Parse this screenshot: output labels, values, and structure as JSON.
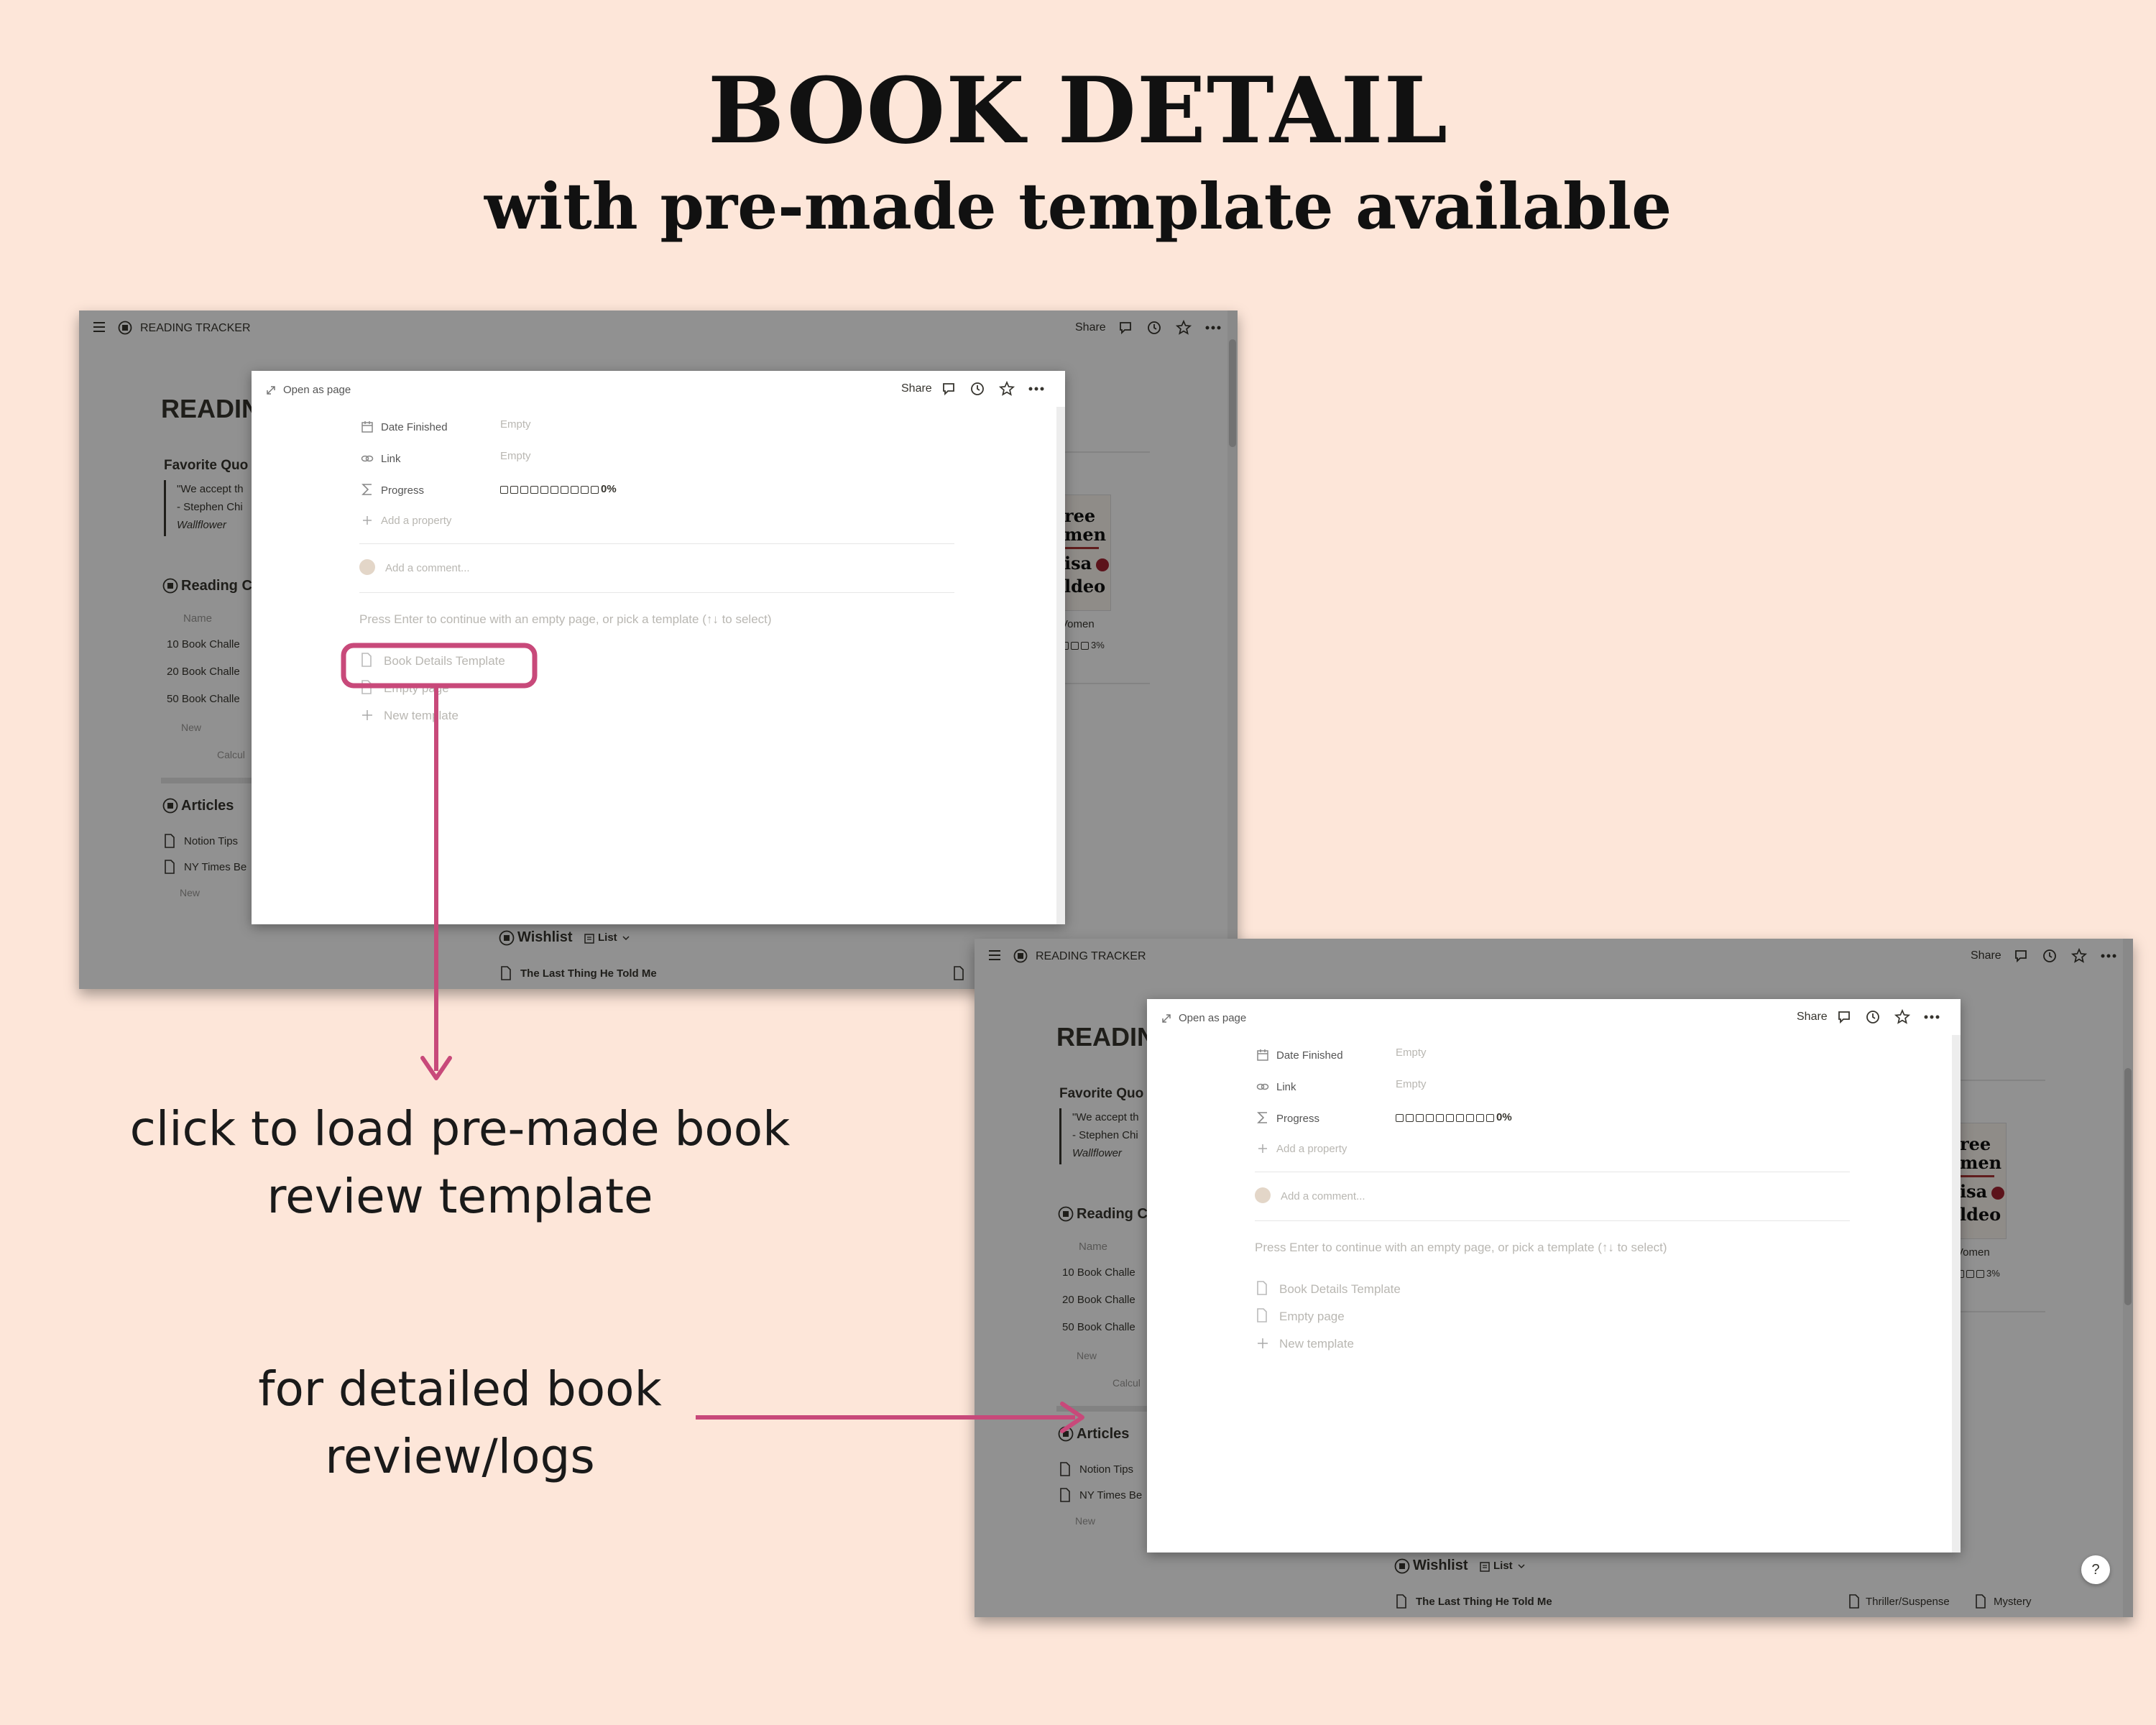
{
  "heading": {
    "title": "BOOK DETAIL",
    "subtitle": "with pre-made template available"
  },
  "captions": {
    "load_line1": "click to load pre-made book",
    "load_line2": "review template",
    "detail_line1": "for detailed book",
    "detail_line2": "review/logs"
  },
  "colors": {
    "accent": "#c8497a",
    "background": "#fde6d9"
  },
  "app": {
    "breadcrumb": "READING TRACKER",
    "share": "Share",
    "page_title": "READIN",
    "favorite_quote_heading": "Favorite Quo",
    "quote_line1": "\"We accept th",
    "quote_line2": "- Stephen Chi",
    "quote_line3": "Wallflower",
    "reading_challenge": "Reading C",
    "name_column": "Name",
    "challenges": [
      "10 Book Challe",
      "20 Book Challe",
      "50 Book Challe"
    ],
    "new_label": "New",
    "calculate": "Calcul",
    "articles": "Articles",
    "article_items": [
      "Notion Tips",
      "NY Times Be"
    ],
    "wishlist": "Wishlist",
    "list_view": "List",
    "wishlist_item": "The Last Thing He Told Me",
    "tags": [
      "Thriller/Suspense",
      "Mystery"
    ],
    "cover_lines": [
      "ree",
      "men",
      "isa",
      "ldeo"
    ],
    "card_title": "Vomen",
    "card_progress": "3%",
    "help": "?"
  },
  "modal": {
    "open_as_page": "Open as page",
    "share": "Share",
    "properties": [
      {
        "icon": "calendar-icon",
        "name": "Date Finished",
        "value": "Empty"
      },
      {
        "icon": "link-icon",
        "name": "Link",
        "value": "Empty"
      },
      {
        "icon": "sigma-icon",
        "name": "Progress",
        "value": "0%"
      }
    ],
    "progress_fraction": 0,
    "add_property": "Add a property",
    "add_comment": "Add a comment...",
    "hint": "Press Enter to continue with an empty page, or pick a template (↑↓ to select)",
    "templates": [
      "Book Details Template",
      "Empty page"
    ],
    "new_template": "New template"
  }
}
